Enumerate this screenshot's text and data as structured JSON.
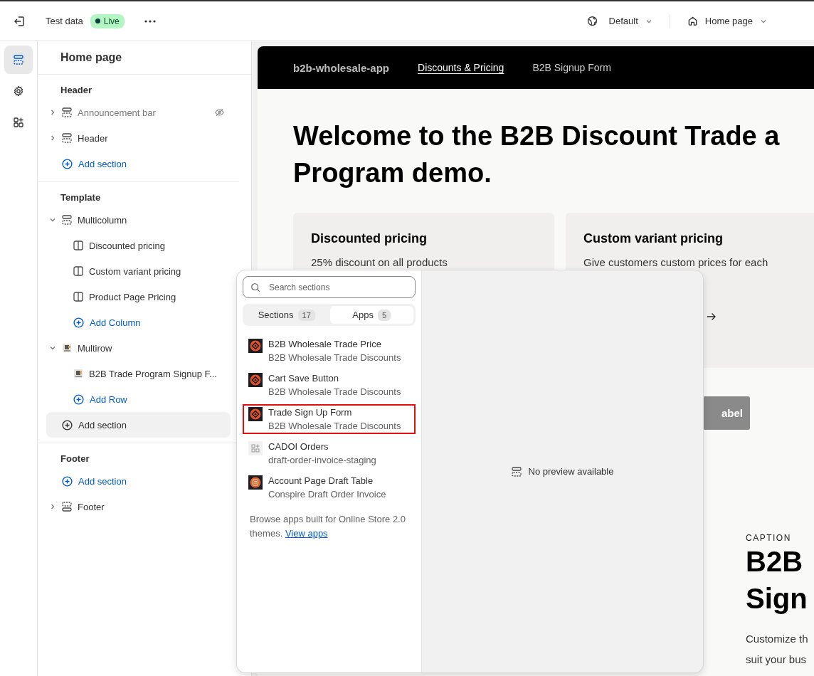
{
  "topbar": {
    "store": "Test data",
    "status": {
      "label": "Live",
      "on": true
    },
    "theme": "Default",
    "page": "Home page"
  },
  "rail": [
    {
      "kind": "sections",
      "selected": true
    },
    {
      "kind": "settings",
      "selected": false
    },
    {
      "kind": "apps",
      "selected": false
    }
  ],
  "panel": {
    "title": "Home page",
    "groups": [
      {
        "title": "Header",
        "items": [
          {
            "kind": "section",
            "label": "Announcement bar",
            "expanded": false,
            "hidden": true
          },
          {
            "kind": "section",
            "label": "Header",
            "expanded": false,
            "hidden": false
          },
          {
            "kind": "add",
            "label": "Add section",
            "selected": false
          }
        ]
      },
      {
        "title": "Template",
        "items": [
          {
            "kind": "section",
            "label": "Multicolumn",
            "expanded": true,
            "hidden": false,
            "children": [
              {
                "kind": "block",
                "label": "Discounted pricing"
              },
              {
                "kind": "block",
                "label": "Custom variant pricing"
              },
              {
                "kind": "block",
                "label": "Product Page Pricing"
              },
              {
                "kind": "add",
                "label": "Add Column"
              }
            ]
          },
          {
            "kind": "app_section",
            "label": "Multirow",
            "expanded": true,
            "hidden": false,
            "children": [
              {
                "kind": "app_block",
                "label": "B2B Trade Program Signup F..."
              },
              {
                "kind": "add",
                "label": "Add Row"
              }
            ]
          },
          {
            "kind": "add",
            "label": "Add section",
            "selected": true
          }
        ]
      },
      {
        "title": "Footer",
        "items": [
          {
            "kind": "add",
            "label": "Add section",
            "selected": false
          },
          {
            "kind": "footer_section",
            "label": "Footer",
            "expanded": false,
            "hidden": false
          }
        ]
      }
    ]
  },
  "preview": {
    "brand": "b2b-wholesale-app",
    "nav": [
      {
        "label": "Discounts & Pricing",
        "selected": true
      },
      {
        "label": "B2B Signup Form",
        "selected": false
      }
    ],
    "heading": [
      "Welcome to the B2B Discount Trade a",
      "Program demo."
    ],
    "cards": [
      {
        "title": "Discounted pricing",
        "text": "25% discount on all products"
      },
      {
        "title": "Custom variant pricing",
        "text": "Give customers custom prices for each"
      }
    ],
    "button": "abel",
    "caption": "CAPTION",
    "title": [
      "B2B",
      "Sign"
    ],
    "body": [
      "Customize th",
      "suit your bus"
    ]
  },
  "picker": {
    "search": {
      "placeholder": "Search sections"
    },
    "tabs": [
      {
        "label": "Sections",
        "count": "17",
        "selected": false
      },
      {
        "label": "Apps",
        "count": "5",
        "selected": true
      }
    ],
    "apps": [
      {
        "kind": "brand",
        "name": "B2B Wholesale Trade Price",
        "vendor": "B2B Wholesale Trade Discounts",
        "highlighted": false
      },
      {
        "kind": "brand",
        "name": "Cart Save Button",
        "vendor": "B2B Wholesale Trade Discounts",
        "highlighted": false
      },
      {
        "kind": "brand",
        "name": "Trade Sign Up Form",
        "vendor": "B2B Wholesale Trade Discounts",
        "highlighted": true
      },
      {
        "kind": "placeholder",
        "name": "CADOI Orders",
        "vendor": "draft-order-invoice-staging",
        "highlighted": false
      },
      {
        "kind": "badge",
        "name": "Account Page Draft Table",
        "vendor": "Conspire Draft Order Invoice",
        "highlighted": false
      }
    ],
    "note": "Browse apps built for Online Store 2.0 themes.",
    "link": "View apps",
    "empty": "No preview available"
  }
}
